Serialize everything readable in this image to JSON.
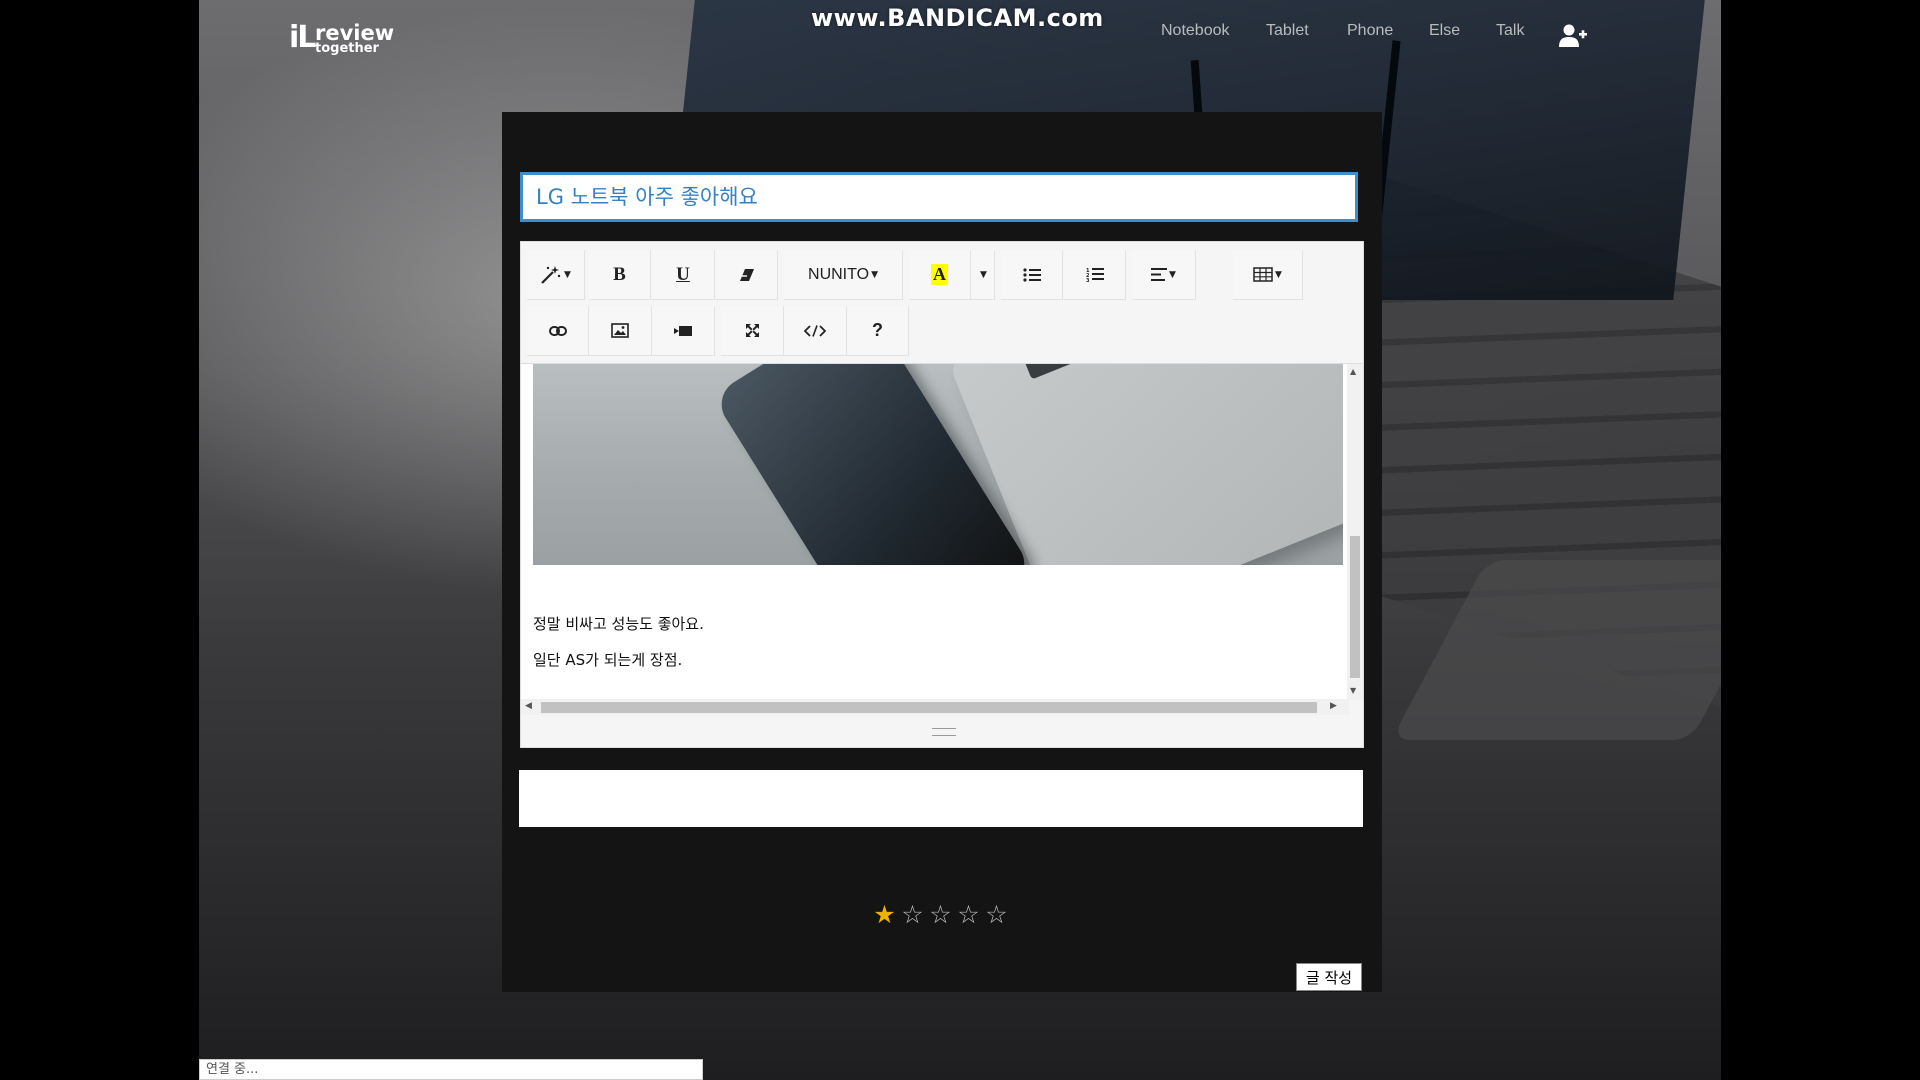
{
  "watermark": "www.BANDICAM.com",
  "logo": {
    "mark": "iL",
    "line1": "review",
    "line2": "together"
  },
  "nav": {
    "items": [
      "Notebook",
      "Tablet",
      "Phone",
      "Else",
      "Talk"
    ]
  },
  "editor": {
    "title_value": "LG 노트북 아주 좋아해요",
    "font_name": "NUNITO",
    "content_lines": [
      "정말 비싸고 성능도 좋아요.",
      "일단 AS가 되는게 장점."
    ]
  },
  "rating": {
    "value": 1,
    "max": 5,
    "star_on": "★",
    "star_off": "☆"
  },
  "submit_label": "글 작성",
  "status_text": "연결 중...",
  "colors": {
    "title_border": "#3b8fd0",
    "title_text": "#3781c2",
    "star": "#f0b000"
  }
}
